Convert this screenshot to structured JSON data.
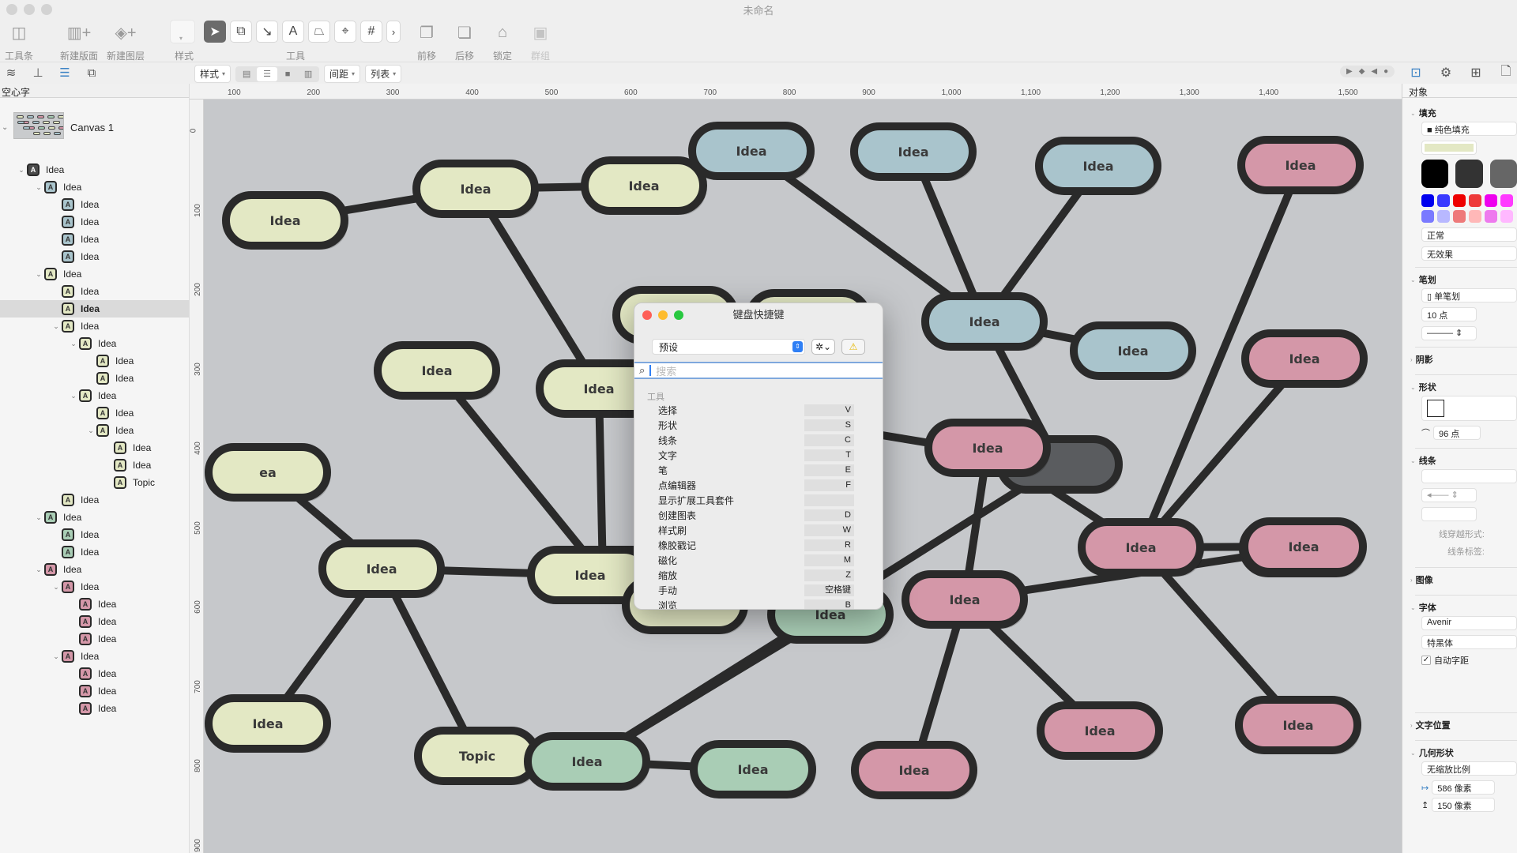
{
  "window": {
    "title": "未命名"
  },
  "toolbar": {
    "left_items": [
      {
        "label": "工具条",
        "icon": "sidebar-toggle-icon"
      },
      {
        "label": "新建版面",
        "icon": "new-canvas-icon"
      },
      {
        "label": "新建图层",
        "icon": "new-layer-icon"
      }
    ],
    "style_label": "样式",
    "tools_label": "工具",
    "tools": [
      {
        "name": "select",
        "glyph": "➤",
        "active": true
      },
      {
        "name": "shape",
        "glyph": "⧉"
      },
      {
        "name": "line",
        "glyph": "↘"
      },
      {
        "name": "text",
        "glyph": "A"
      },
      {
        "name": "pen",
        "glyph": "⏢"
      },
      {
        "name": "point-editor",
        "glyph": "⌖"
      },
      {
        "name": "grid",
        "glyph": "#"
      },
      {
        "name": "more",
        "glyph": "›"
      }
    ],
    "right_items": [
      {
        "label": "前移",
        "icon": "bring-forward-icon",
        "glyph": "❐"
      },
      {
        "label": "后移",
        "icon": "send-backward-icon",
        "glyph": "❏"
      },
      {
        "label": "锁定",
        "icon": "lock-icon",
        "glyph": "🔒"
      },
      {
        "label": "群组",
        "icon": "group-icon",
        "glyph": "▣",
        "disabled": true
      }
    ]
  },
  "format_bar": {
    "style": "样式",
    "spacing": "间距",
    "list": "列表",
    "align": [
      "left",
      "center",
      "justify",
      "right"
    ],
    "align_selected": 1
  },
  "sidebar": {
    "header": "空心字",
    "canvas_label": "Canvas 1",
    "items": [
      {
        "label": "Idea",
        "level": 0,
        "color": "dark",
        "expanded": true
      },
      {
        "label": "Idea",
        "level": 1,
        "color": "blue",
        "expanded": true
      },
      {
        "label": "Idea",
        "level": 2,
        "color": "blue"
      },
      {
        "label": "Idea",
        "level": 2,
        "color": "blue"
      },
      {
        "label": "Idea",
        "level": 2,
        "color": "blue"
      },
      {
        "label": "Idea",
        "level": 2,
        "color": "blue"
      },
      {
        "label": "Idea",
        "level": 1,
        "color": "yellow",
        "expanded": true
      },
      {
        "label": "Idea",
        "level": 2,
        "color": "yellow"
      },
      {
        "label": "Idea",
        "level": 2,
        "color": "yellow",
        "selected": true
      },
      {
        "label": "Idea",
        "level": 2,
        "color": "yellow",
        "expanded": true
      },
      {
        "label": "Idea",
        "level": 3,
        "color": "yellow",
        "expanded": true
      },
      {
        "label": "Idea",
        "level": 4,
        "color": "yellow"
      },
      {
        "label": "Idea",
        "level": 4,
        "color": "yellow"
      },
      {
        "label": "Idea",
        "level": 3,
        "color": "yellow",
        "expanded": true
      },
      {
        "label": "Idea",
        "level": 4,
        "color": "yellow"
      },
      {
        "label": "Idea",
        "level": 4,
        "color": "yellow",
        "expanded": true
      },
      {
        "label": "Idea",
        "level": 5,
        "color": "yellow"
      },
      {
        "label": "Idea",
        "level": 5,
        "color": "yellow"
      },
      {
        "label": "Topic",
        "level": 5,
        "color": "yellow"
      },
      {
        "label": "Idea",
        "level": 2,
        "color": "yellow"
      },
      {
        "label": "Idea",
        "level": 1,
        "color": "green",
        "expanded": true
      },
      {
        "label": "Idea",
        "level": 2,
        "color": "green"
      },
      {
        "label": "Idea",
        "level": 2,
        "color": "green"
      },
      {
        "label": "Idea",
        "level": 1,
        "color": "pink",
        "expanded": true
      },
      {
        "label": "Idea",
        "level": 2,
        "color": "pink",
        "expanded": true
      },
      {
        "label": "Idea",
        "level": 3,
        "color": "pink"
      },
      {
        "label": "Idea",
        "level": 3,
        "color": "pink"
      },
      {
        "label": "Idea",
        "level": 3,
        "color": "pink"
      },
      {
        "label": "Idea",
        "level": 2,
        "color": "pink",
        "expanded": true
      },
      {
        "label": "Idea",
        "level": 3,
        "color": "pink"
      },
      {
        "label": "Idea",
        "level": 3,
        "color": "pink"
      },
      {
        "label": "Idea",
        "level": 3,
        "color": "pink"
      }
    ]
  },
  "colors": {
    "dark": "#5a5c5f",
    "blue": "#a9c4cc",
    "yellow": "#e3e8c4",
    "green": "#a9cdb5",
    "pink": "#d497a8",
    "canvas": "#c6c8cb",
    "outline": "#2a2a2a"
  },
  "rulers": {
    "top": [
      "100",
      "200",
      "300",
      "400",
      "500",
      "600",
      "700",
      "800",
      "900",
      "1,000",
      "1,100",
      "1,200",
      "1,300",
      "1,400",
      "1,500"
    ],
    "left": [
      "0",
      "100",
      "200",
      "300",
      "400",
      "500",
      "600",
      "700",
      "800",
      "900"
    ]
  },
  "canvas": {
    "nodes": [
      {
        "id": "c",
        "label": "",
        "color": "dark"
      },
      {
        "id": "y1",
        "label": "Idea",
        "color": "yellow"
      },
      {
        "id": "y2",
        "label": "Idea",
        "color": "yellow"
      },
      {
        "id": "y3",
        "label": "Idea",
        "color": "yellow"
      },
      {
        "id": "y4",
        "label": "Idea",
        "color": "yellow"
      },
      {
        "id": "y5",
        "label": "Idea",
        "color": "yellow"
      },
      {
        "id": "y6",
        "label": "Idea",
        "color": "yellow"
      },
      {
        "id": "y7",
        "label": "Idea",
        "color": "yellow",
        "editing": true
      },
      {
        "id": "y8",
        "label": "Idea",
        "color": "yellow"
      },
      {
        "id": "y9",
        "label": "ea",
        "color": "yellow"
      },
      {
        "id": "y10",
        "label": "Idea",
        "color": "yellow"
      },
      {
        "id": "y11",
        "label": "Idea",
        "color": "yellow"
      },
      {
        "id": "y12",
        "label": "Idea",
        "color": "yellow"
      },
      {
        "id": "y13",
        "label": "Topic",
        "color": "yellow"
      },
      {
        "id": "y14",
        "label": "Idea",
        "color": "yellow"
      },
      {
        "id": "b1",
        "label": "Idea",
        "color": "blue"
      },
      {
        "id": "b2",
        "label": "Idea",
        "color": "blue"
      },
      {
        "id": "b3",
        "label": "Idea",
        "color": "blue"
      },
      {
        "id": "b4",
        "label": "Idea",
        "color": "blue"
      },
      {
        "id": "b5",
        "label": "Idea",
        "color": "blue"
      },
      {
        "id": "g1",
        "label": "Idea",
        "color": "green"
      },
      {
        "id": "g2",
        "label": "Idea",
        "color": "green"
      },
      {
        "id": "g3",
        "label": "Idea",
        "color": "green"
      },
      {
        "id": "p1",
        "label": "Idea",
        "color": "pink"
      },
      {
        "id": "p2",
        "label": "Idea",
        "color": "pink"
      },
      {
        "id": "p3",
        "label": "Idea",
        "color": "pink"
      },
      {
        "id": "p4",
        "label": "Idea",
        "color": "pink"
      },
      {
        "id": "p5",
        "label": "Idea",
        "color": "pink"
      },
      {
        "id": "p6",
        "label": "Idea",
        "color": "pink"
      },
      {
        "id": "p7",
        "label": "Idea",
        "color": "pink"
      },
      {
        "id": "p8",
        "label": "Idea",
        "color": "pink"
      },
      {
        "id": "p9",
        "label": "Idea",
        "color": "pink"
      },
      {
        "id": "p10",
        "label": "Idea",
        "color": "pink"
      }
    ],
    "edges": [
      [
        "y1",
        "y2"
      ],
      [
        "y2",
        "y3"
      ],
      [
        "y2",
        "y5"
      ],
      [
        "y5",
        "y6"
      ],
      [
        "y6",
        "y4"
      ],
      [
        "y5",
        "c"
      ],
      [
        "y9",
        "y10"
      ],
      [
        "y10",
        "y11"
      ],
      [
        "y10",
        "y12"
      ],
      [
        "y10",
        "y13"
      ],
      [
        "y11",
        "y6"
      ],
      [
        "c",
        "b5"
      ],
      [
        "b5",
        "b1"
      ],
      [
        "b5",
        "b2"
      ],
      [
        "b5",
        "b3"
      ],
      [
        "b5",
        "b4"
      ],
      [
        "c",
        "p1"
      ],
      [
        "p1",
        "p2"
      ],
      [
        "p1",
        "p3"
      ],
      [
        "p2",
        "p4"
      ],
      [
        "p2",
        "p5"
      ],
      [
        "p2",
        "p6"
      ],
      [
        "p3",
        "p7"
      ],
      [
        "p3",
        "p8"
      ],
      [
        "p3",
        "p9"
      ],
      [
        "p3",
        "p10"
      ],
      [
        "c",
        "g1"
      ],
      [
        "g1",
        "g2"
      ],
      [
        "g1",
        "g3"
      ]
    ]
  },
  "dialog": {
    "title": "键盘快捷键",
    "preset": "预设",
    "search_placeholder": "搜索",
    "section": "工具",
    "shortcuts": [
      {
        "action": "选择",
        "key": "V"
      },
      {
        "action": "形状",
        "key": "S"
      },
      {
        "action": "线条",
        "key": "C"
      },
      {
        "action": "文字",
        "key": "T"
      },
      {
        "action": "笔",
        "key": "E"
      },
      {
        "action": "点编辑器",
        "key": "F"
      },
      {
        "action": "显示扩展工具套件",
        "key": ""
      },
      {
        "action": "创建图表",
        "key": "D"
      },
      {
        "action": "样式刷",
        "key": "W"
      },
      {
        "action": "橡胶戳记",
        "key": "R"
      },
      {
        "action": "磁化",
        "key": "M"
      },
      {
        "action": "缩放",
        "key": "Z"
      },
      {
        "action": "手动",
        "key": "空格键"
      },
      {
        "action": "浏览",
        "key": "B"
      }
    ]
  },
  "inspector": {
    "header": "对象",
    "fill": {
      "title": "填充",
      "type": "纯色填充",
      "color": "#e3e8c4",
      "blend": "正常",
      "effect": "无效果",
      "big_swatches": [
        "#000000",
        "#333333",
        "#666666"
      ],
      "small_swatches": [
        "#0000ee",
        "#3a3aff",
        "#ee0000",
        "#ee3a3a",
        "#ee00ee",
        "#ff3aff",
        "#7a7aff",
        "#b8b8ff",
        "#ee7a7a",
        "#ffb8b8",
        "#ee7aee",
        "#ffb8ff"
      ]
    },
    "stroke": {
      "title": "笔划",
      "type": "单笔划",
      "width": "10 点"
    },
    "shadow": {
      "title": "阴影"
    },
    "shape": {
      "title": "形状",
      "corner_radius": "96 点"
    },
    "lines": {
      "title": "线条",
      "hop_label": "线穿越形式:",
      "label_label": "线条标签:"
    },
    "image": {
      "title": "图像"
    },
    "font": {
      "title": "字体",
      "family": "Avenir",
      "weight": "特黑体",
      "auto_kern_label": "自动字距",
      "auto_kern": true
    },
    "text_position": {
      "title": "文字位置"
    },
    "geometry": {
      "title": "几何形状",
      "scale": "无缩放比例",
      "width": "586 像素",
      "height": "150 像素"
    }
  }
}
